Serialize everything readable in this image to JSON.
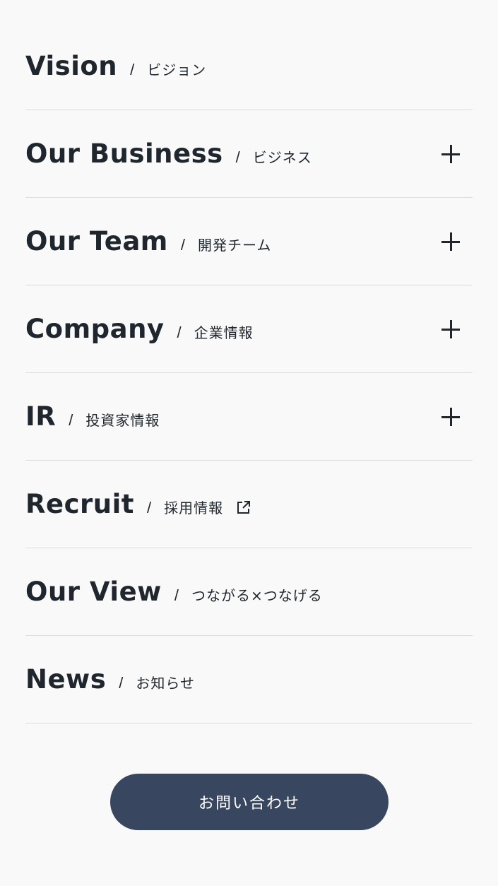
{
  "menu": {
    "items": [
      {
        "en": "Vision",
        "slash": "/",
        "ja": "ビジョン",
        "expandable": false,
        "external": false
      },
      {
        "en": "Our Business",
        "slash": "/",
        "ja": "ビジネス",
        "expandable": true,
        "external": false
      },
      {
        "en": "Our Team",
        "slash": "/",
        "ja": "開発チーム",
        "expandable": true,
        "external": false
      },
      {
        "en": "Company",
        "slash": "/",
        "ja": "企業情報",
        "expandable": true,
        "external": false
      },
      {
        "en": "IR",
        "slash": "/",
        "ja": "投資家情報",
        "expandable": true,
        "external": false
      },
      {
        "en": "Recruit",
        "slash": "/",
        "ja": "採用情報",
        "expandable": false,
        "external": true
      },
      {
        "en": "Our View",
        "slash": "/",
        "ja": "つながる×つなげる",
        "expandable": false,
        "external": false
      },
      {
        "en": "News",
        "slash": "/",
        "ja": "お知らせ",
        "expandable": false,
        "external": false
      }
    ]
  },
  "contact": {
    "label": "お問い合わせ"
  },
  "colors": {
    "background": "#f9f9f9",
    "text": "#1f262d",
    "divider": "#dddddd",
    "button": "#39465f"
  },
  "icons": {
    "expand": "plus-icon",
    "external": "external-link-icon"
  }
}
